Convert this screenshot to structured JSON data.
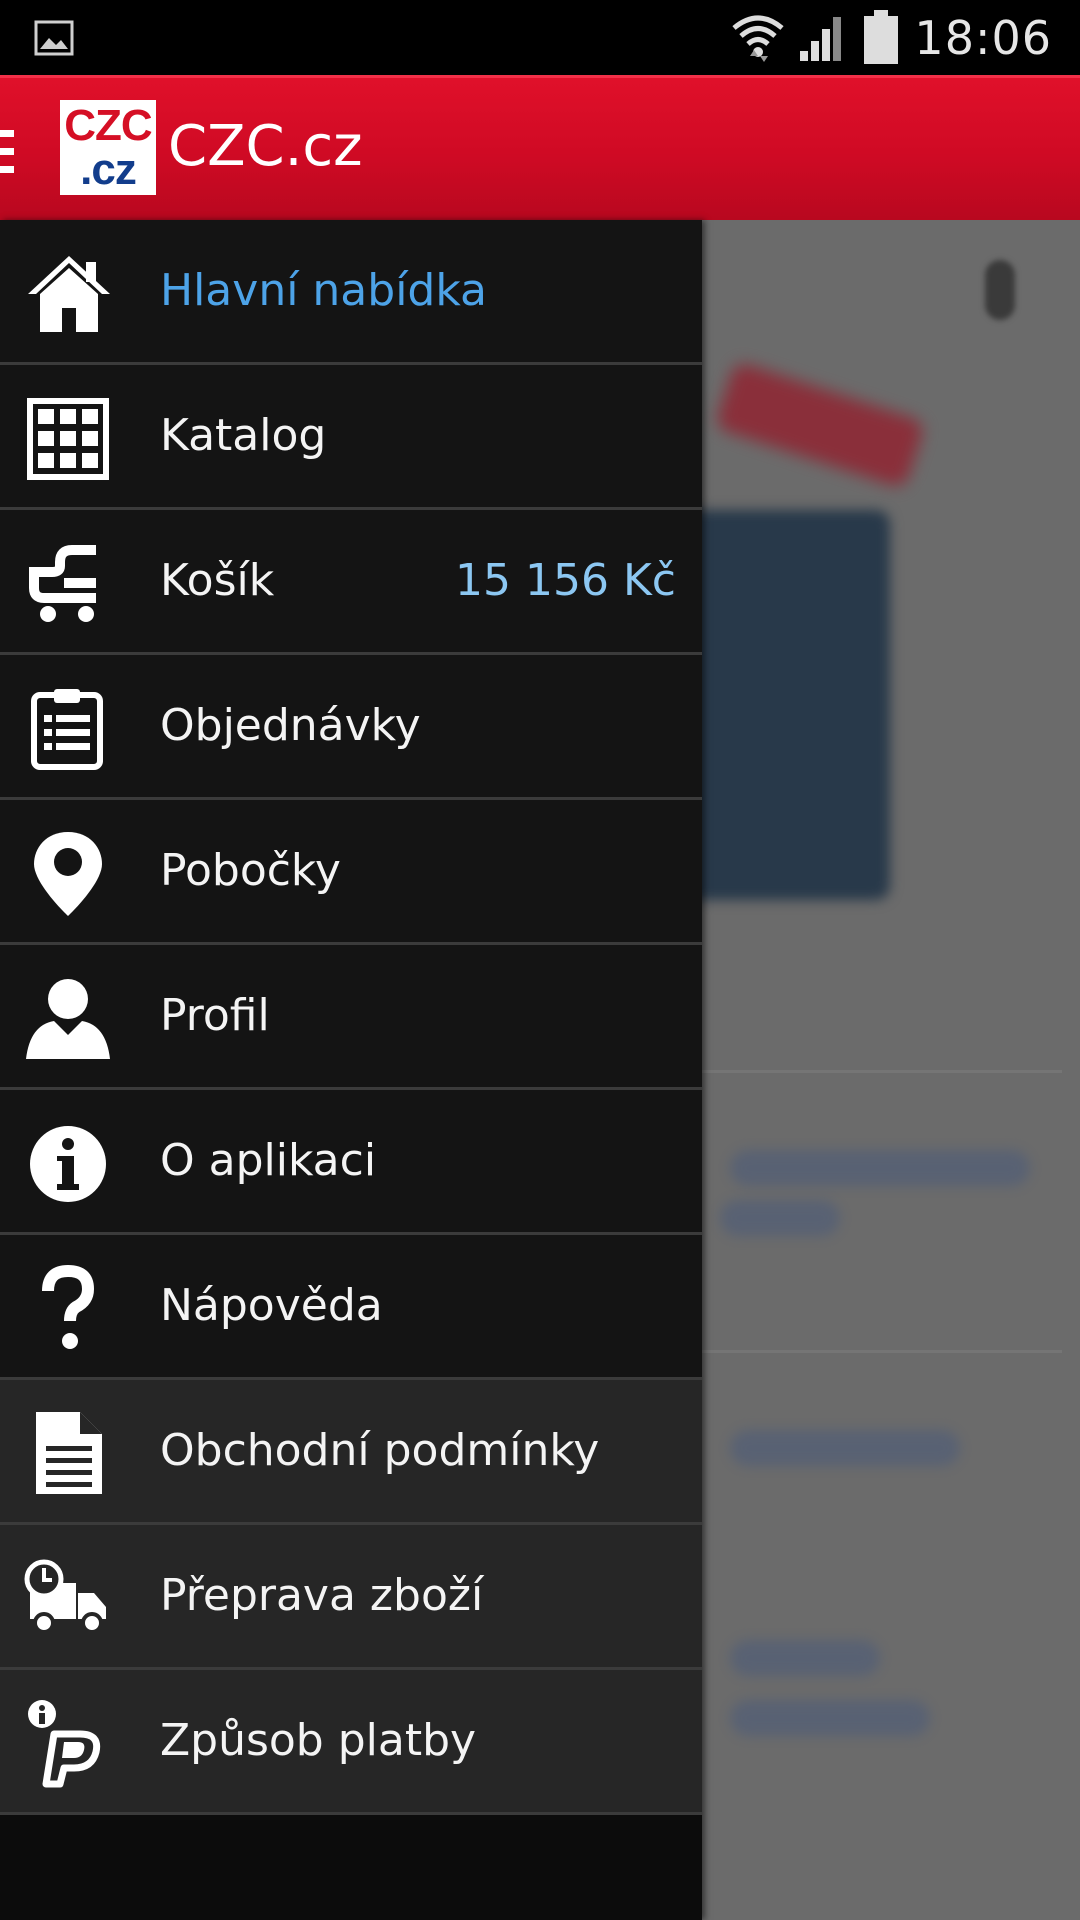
{
  "status_bar": {
    "time": "18:06"
  },
  "app_bar": {
    "logo_line1": "CZC",
    "logo_line2": ".cz",
    "title": "CZC.cz"
  },
  "drawer": {
    "items": [
      {
        "label": "Hlavní nabídka",
        "icon": "home-icon",
        "active": true
      },
      {
        "label": "Katalog",
        "icon": "grid-icon"
      },
      {
        "label": "Košík",
        "icon": "cart-icon",
        "value": "15 156 Kč"
      },
      {
        "label": "Objednávky",
        "icon": "clipboard-icon"
      },
      {
        "label": "Pobočky",
        "icon": "location-pin-icon"
      },
      {
        "label": "Profil",
        "icon": "user-icon"
      },
      {
        "label": "O aplikaci",
        "icon": "info-icon"
      },
      {
        "label": "Nápověda",
        "icon": "help-icon"
      },
      {
        "label": "Obchodní podmínky",
        "icon": "document-icon"
      },
      {
        "label": "Přeprava zboží",
        "icon": "delivery-truck-icon"
      },
      {
        "label": "Způsob platby",
        "icon": "payment-icon"
      }
    ]
  },
  "colors": {
    "brand_red": "#d50f25",
    "accent_blue": "#4da3e8",
    "price_blue": "#8cc7f2"
  }
}
